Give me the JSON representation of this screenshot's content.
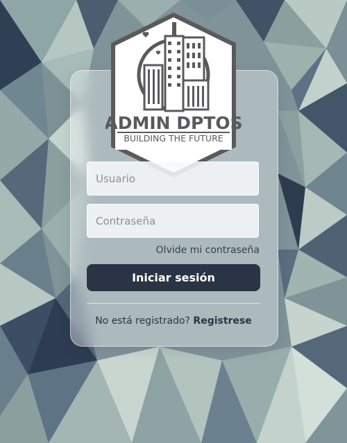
{
  "logo": {
    "title": "ADMIN DPTOS",
    "subtitle": "BUILDING THE FUTURE"
  },
  "form": {
    "username_placeholder": "Usuario",
    "username_value": "",
    "password_placeholder": "Contraseña",
    "password_value": "",
    "forgot_password_label": "Olvide mi contraseña",
    "login_button_label": "Iniciar sesión",
    "register_prompt": "No está registrado?",
    "register_link_label": "Registrese"
  },
  "colors": {
    "button": "#2b3444",
    "logo_gray": "#5a5a5c"
  },
  "icons": [
    "city-buildings-icon",
    "heart-icon"
  ]
}
